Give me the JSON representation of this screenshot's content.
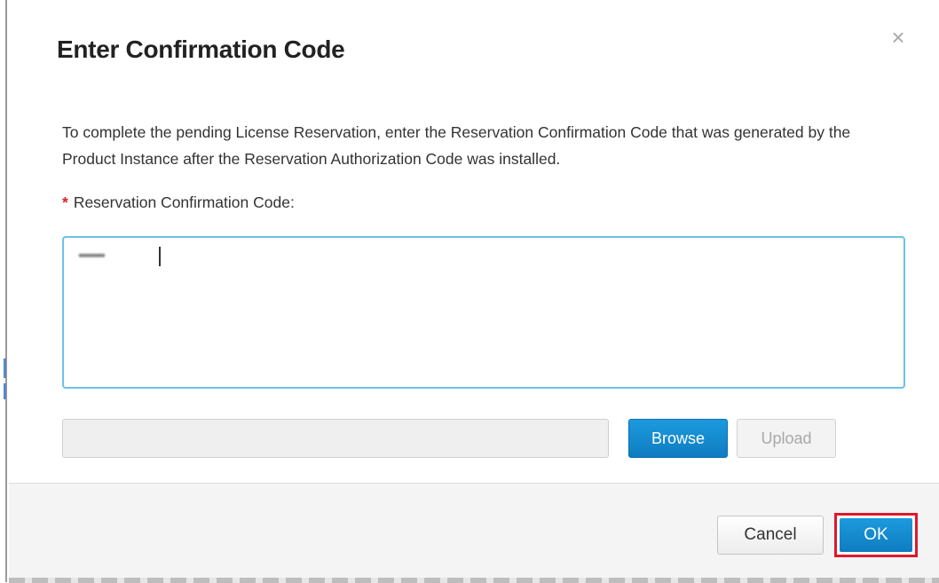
{
  "dialog": {
    "title": "Enter Confirmation Code",
    "close_glyph": "×",
    "description": "To complete the pending License Reservation, enter the Reservation Confirmation Code that was generated by the Product Instance after the Reservation Authorization Code was installed.",
    "field_required_marker": "*",
    "field_label": "Reservation Confirmation Code:",
    "code_value": "••••••••",
    "file_path_value": "",
    "browse_label": "Browse",
    "upload_label": "Upload",
    "cancel_label": "Cancel",
    "ok_label": "OK"
  },
  "icons": {
    "close": "close-icon"
  },
  "colors": {
    "primary_button": "#1589d0",
    "focus_border": "#6cc2e8",
    "required_star": "#d8232a",
    "highlight_outline": "#e0182b"
  }
}
